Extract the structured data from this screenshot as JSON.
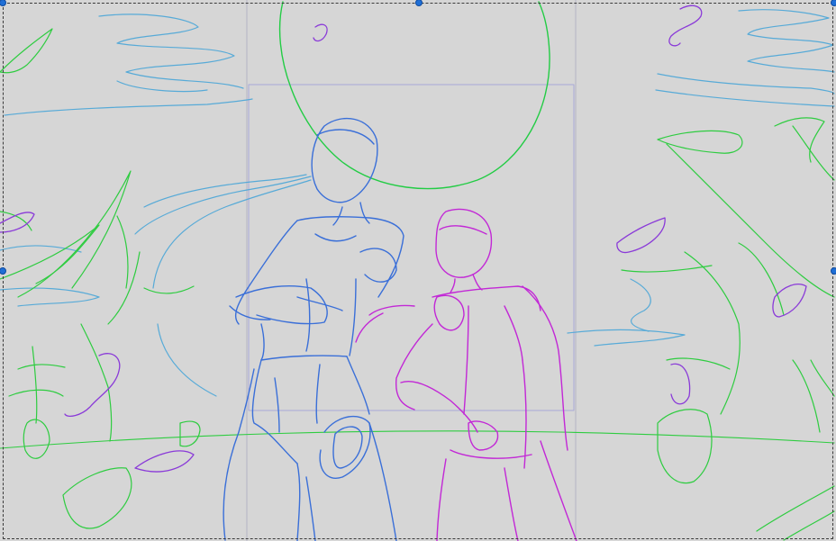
{
  "canvas": {
    "background": "#d6d6d6",
    "guide_color": "#a9a9c8"
  },
  "layers": {
    "sky_color": "#4aa6d8",
    "moon_color": "#22cc44",
    "foliage_color": "#2ecc40",
    "blue_figure_color": "#3a6fd8",
    "magenta_figure_color": "#c228d6",
    "purple_accent_color": "#8a3ad8"
  },
  "selection": {
    "handle_color": "#1f6fd6",
    "frame_style": "dashed"
  }
}
